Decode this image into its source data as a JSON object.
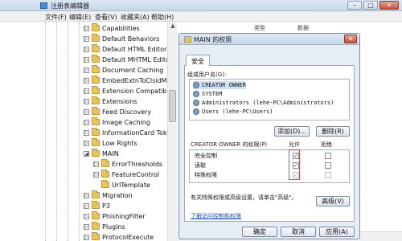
{
  "app": {
    "title": "注册表编辑器",
    "window_buttons": {
      "minimize": "–",
      "maximize": "□",
      "close": "✕"
    },
    "menu": [
      "文件(F)",
      "编辑(E)",
      "查看(V)",
      "收藏夹(A)",
      "帮助(H)"
    ]
  },
  "right_columns": {
    "type": "类型",
    "data": "数据"
  },
  "tree": {
    "items": [
      {
        "label": "Capabilities",
        "expander": "▷"
      },
      {
        "label": "Default Behaviors",
        "expander": "▷"
      },
      {
        "label": "Default HTML Editor",
        "expander": "▷"
      },
      {
        "label": "Default MHTML Editor",
        "expander": "▷"
      },
      {
        "label": "Document Caching",
        "expander": "▷"
      },
      {
        "label": "EmbedExtnToClsidMap",
        "expander": "▷"
      },
      {
        "label": "Extension Compatibilit",
        "expander": "▷"
      },
      {
        "label": "Extensions",
        "expander": "▷"
      },
      {
        "label": "Feed Discovery",
        "expander": "▷"
      },
      {
        "label": "Image Caching",
        "expander": "▷"
      },
      {
        "label": "InformationCard Toker",
        "expander": "▷"
      },
      {
        "label": "Low Rights",
        "expander": "▷"
      },
      {
        "label": "MAIN",
        "expander": "◢"
      },
      {
        "label": "ErrorThresholds",
        "expander": "▷"
      },
      {
        "label": "FeatureControl",
        "expander": "▷"
      },
      {
        "label": "UrlTemplate",
        "expander": ""
      },
      {
        "label": "Migration",
        "expander": "▷"
      },
      {
        "label": "P3",
        "expander": "▷"
      },
      {
        "label": "PhishingFilter",
        "expander": "▷"
      },
      {
        "label": "Plugins",
        "expander": "▷"
      },
      {
        "label": "ProtocolExecute",
        "expander": "▷"
      }
    ]
  },
  "dialog": {
    "title": "MAIN 的权限",
    "close": "✕",
    "tab": "安全",
    "group_label": "组或用户名(G):",
    "users": [
      "CREATOR OWNER",
      "SYSTEM",
      "Administrators (lehe-PC\\Administrators)",
      "Users (lehe-PC\\Users)"
    ],
    "add_button": "添加(D)...",
    "remove_button": "删除(R)",
    "perm_label": "CREATOR OWNER 的权限(P)",
    "allow_header": "允许",
    "deny_header": "拒绝",
    "permissions": [
      {
        "name": "完全控制",
        "allow": "✓"
      },
      {
        "name": "读取",
        "allow": "✓"
      },
      {
        "name": "特殊权限",
        "allow": "✓"
      }
    ],
    "advanced_text": "有关特殊权限或高级设置，请单击\"高级\"。",
    "advanced_button": "高级(V)",
    "link": "了解访问控制和权限",
    "ok": "确定",
    "cancel": "取消",
    "apply": "应用(A)"
  }
}
